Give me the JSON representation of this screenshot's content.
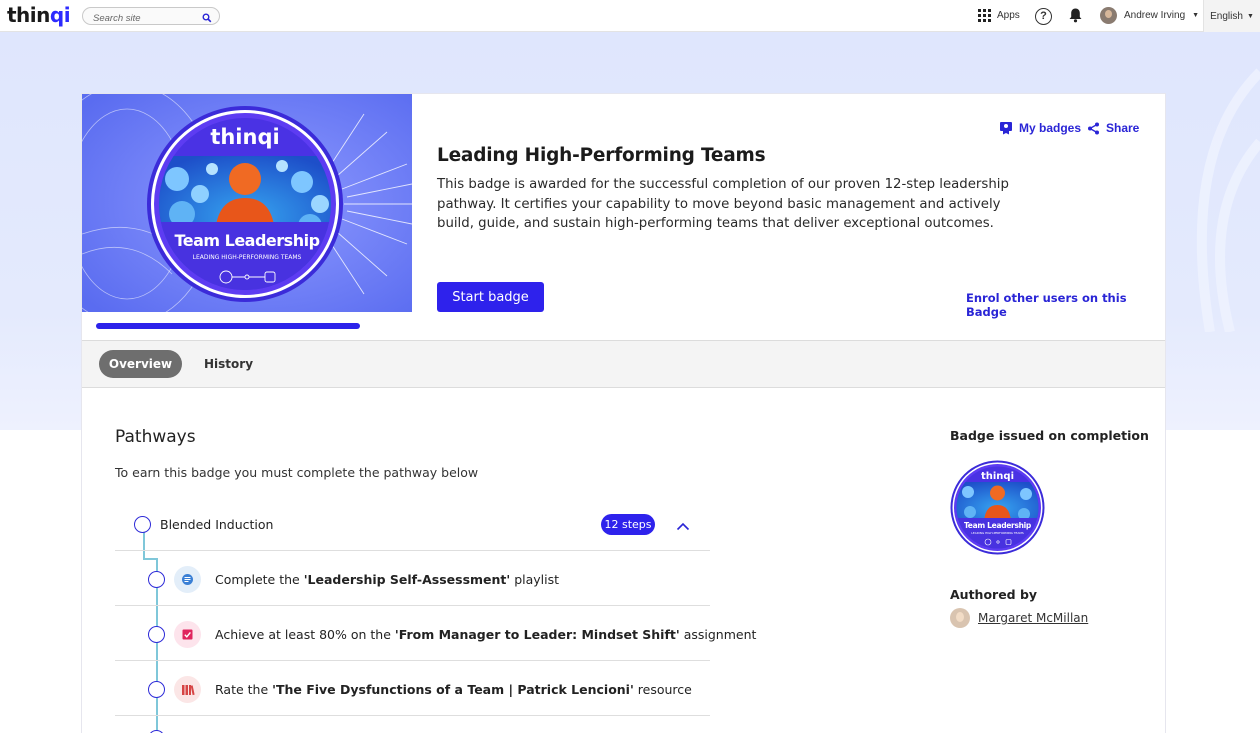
{
  "topbar": {
    "logo_main": "thin",
    "logo_accent": "qi",
    "search_placeholder": "Search site",
    "apps_label": "Apps",
    "user_name": "Andrew Irving",
    "language": "English"
  },
  "badge": {
    "title": "Leading High-Performing Teams",
    "description": "This badge is awarded for the successful completion of our proven 12-step leadership pathway. It certifies your capability to move beyond basic management and actively build, guide, and sustain high-performing teams that deliver exceptional outcomes.",
    "my_badges_label": "My badges",
    "share_label": "Share",
    "start_label": "Start badge",
    "enrol_label": "Enrol other users on this Badge",
    "image_logo": "thinqi",
    "image_title": "Team Leadership",
    "image_subtitle": "LEADING HIGH-PERFORMING TEAMS",
    "progress_fraction": 1.0
  },
  "tabs": {
    "overview": "Overview",
    "history": "History"
  },
  "pathways": {
    "heading": "Pathways",
    "subheading": "To earn this badge you must complete the pathway below",
    "pathway_name": "Blended Induction",
    "steps_count": "12 steps",
    "steps": [
      {
        "prefix": "Complete the ",
        "bold": "'Leadership Self-Assessment'",
        "suffix": " playlist",
        "icon": "playlist-icon",
        "icon_color": "#3a7fd5",
        "icon_bg": "#e3eef9"
      },
      {
        "prefix": "Achieve at least 80% on the ",
        "bold": "'From Manager to Leader: Mindset Shift'",
        "suffix": " assignment",
        "icon": "assignment-icon",
        "icon_color": "#e0245e",
        "icon_bg": "#fde4ec"
      },
      {
        "prefix": "Rate the ",
        "bold": "'The Five Dysfunctions of a Team | Patrick Lencioni'",
        "suffix": " resource",
        "icon": "books-icon",
        "icon_color": "#d64545",
        "icon_bg": "#fbe6e6"
      }
    ]
  },
  "sidebar": {
    "issued_label": "Badge issued on completion",
    "authored_label": "Authored by",
    "author_name": "Margaret McMillan"
  },
  "colors": {
    "accent": "#2e22ec",
    "link": "#2a25d6",
    "band": "#dfe6fd",
    "tab_active": "#6e6e6e"
  }
}
